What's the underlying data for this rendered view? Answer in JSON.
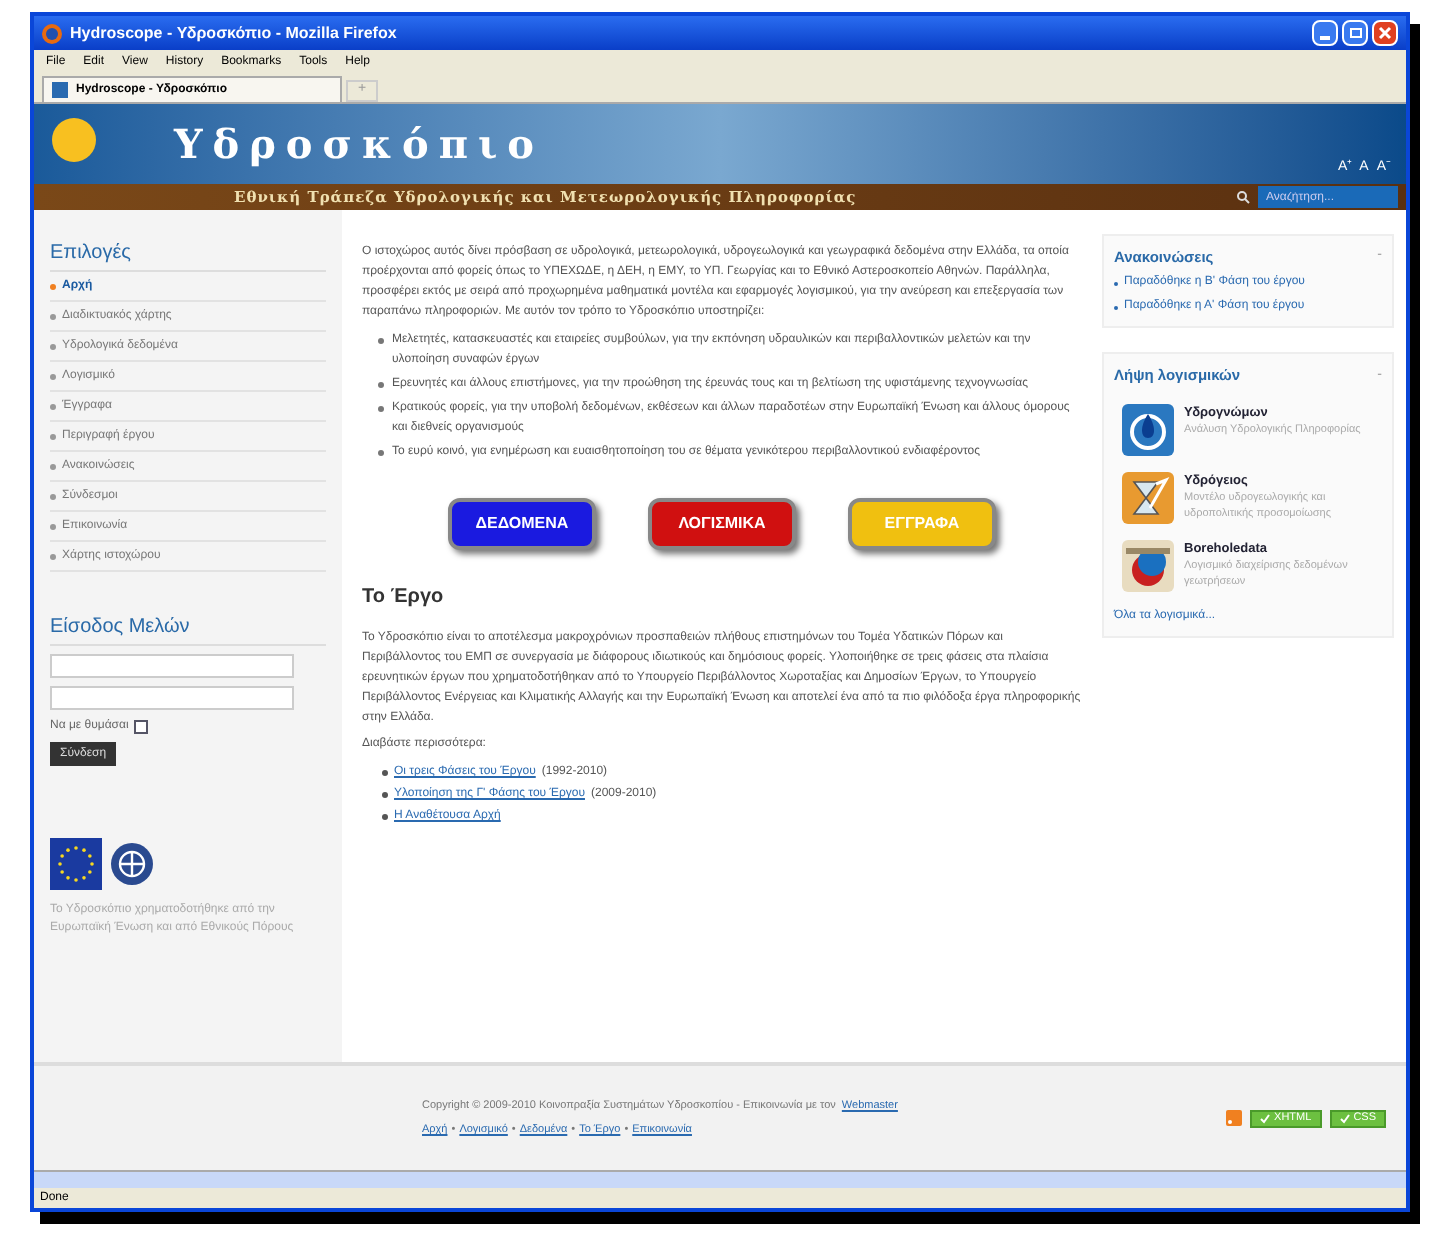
{
  "browser": {
    "title": "Hydroscope - Υδροσκόπιο - Mozilla Firefox",
    "menu": [
      "File",
      "Edit",
      "View",
      "History",
      "Bookmarks",
      "Tools",
      "Help"
    ],
    "tab": "Hydroscope - Υδροσκόπιο",
    "new_tab": "+",
    "status": "Done"
  },
  "header": {
    "title": "Υδροσκόπιο",
    "subtitle": "Εθνική Τράπεζα Υδρολογικής και Μετεωρολογικής Πληροφορίας",
    "font_sizes": [
      "A⁺",
      "A",
      "A⁻"
    ],
    "search": {
      "placeholder": "Αναζήτηση..."
    }
  },
  "sidebar": {
    "menu_title": "Επιλογές",
    "items": [
      {
        "label": "Αρχή",
        "selected": true
      },
      {
        "label": "Διαδικτυακός χάρτης",
        "selected": false
      },
      {
        "label": "Υδρολογικά δεδομένα",
        "selected": false
      },
      {
        "label": "Λογισμικό",
        "selected": false
      },
      {
        "label": "Έγγραφα",
        "selected": false
      },
      {
        "label": "Περιγραφή έργου",
        "selected": false
      },
      {
        "label": "Ανακοινώσεις",
        "selected": false
      },
      {
        "label": "Σύνδεσμοι",
        "selected": false
      },
      {
        "label": "Επικοινωνία",
        "selected": false
      },
      {
        "label": "Χάρτης ιστοχώρου",
        "selected": false
      }
    ],
    "login": {
      "title": "Είσοδος Μελών",
      "remember": {
        "label": "Να με θυμάσαι",
        "checked": false
      },
      "submit": "Σύνδεση"
    },
    "funding": "Το Υδροσκόπιο χρηματοδοτήθηκε από την Ευρωπαϊκή Ένωση και από Εθνικούς Πόρους"
  },
  "main": {
    "intro": "Ο ιστοχώρος αυτός δίνει πρόσβαση σε υδρολογικά, μετεωρολογικά, υδρογεωλογικά και γεωγραφικά δεδομένα στην Ελλάδα, τα οποία προέρχονται από φορείς όπως το ΥΠΕΧΩΔΕ, η ΔΕΗ, η ΕΜΥ, το ΥΠ. Γεωργίας και το Εθνικό Αστεροσκοπείο Αθηνών. Παράλληλα, προσφέρει εκτός με σειρά από προχωρημένα μαθηματικά μοντέλα και εφαρμογές λογισμικού, για την ανεύρεση και επεξεργασία των παραπάνω πληροφοριών. Με αυτόν τον τρόπο το Υδροσκόπιο υποστηρίζει:",
    "bullets": [
      "Μελετητές, κατασκευαστές και εταιρείες συμβούλων, για την εκπόνηση υδραυλικών και περιβαλλοντικών μελετών και την υλοποίηση συναφών έργων",
      "Ερευνητές και άλλους επιστήμονες, για την προώθηση της έρευνάς τους και τη βελτίωση της υφιστάμενης τεχνογνωσίας",
      "Κρατικούς φορείς, για την υποβολή δεδομένων, εκθέσεων και άλλων παραδοτέων στην Ευρωπαϊκή Ένωση και άλλους όμορους και διεθνείς οργανισμούς",
      "Το ευρύ κοινό, για ενημέρωση και ευαισθητοποίηση του σε θέματα γενικότερου περιβαλλοντικού ενδιαφέροντος"
    ],
    "buttons": [
      {
        "label": "ΔΕΔΟΜΕΝΑ",
        "color": "#1a1ae0"
      },
      {
        "label": "ΛΟΓΙΣΜΙΚΑ",
        "color": "#d01010"
      },
      {
        "label": "ΕΓΓΡΑΦΑ",
        "color": "#f0c010"
      }
    ],
    "project": {
      "title": "Το Έργο",
      "text": "Το Υδροσκόπιο είναι το αποτέλεσμα μακροχρόνιων προσπαθειών πλήθους επιστημόνων του Τομέα Υδατικών Πόρων και Περιβάλλοντος του ΕΜΠ σε συνεργασία με διάφορους ιδιωτικούς και δημόσιους φορείς. Υλοποιήθηκε σε τρεις φάσεις στα πλαίσια ερευνητικών έργων που χρηματοδοτήθηκαν από το Υπουργείο Περιβάλλοντος Χωροταξίας και Δημοσίων Έργων, το Υπουργείο Περιβάλλοντος Ενέργειας και Κλιματικής Αλλαγής και την Ευρωπαϊκή Ένωση και αποτελεί ένα από τα πιο φιλόδοξα έργα πληροφορικής στην Ελλάδα.",
      "read_more": "Διαβάστε περισσότερα:",
      "links": [
        {
          "label": "Οι τρεις Φάσεις του Έργου",
          "suffix": "(1992-2010)"
        },
        {
          "label": "Υλοποίηση της Γ' Φάσης του Έργου",
          "suffix": "(2009-2010)"
        },
        {
          "label": "Η Αναθέτουσα Αρχή"
        }
      ]
    }
  },
  "right": {
    "news": {
      "title": "Ανακοινώσεις",
      "toggle": "-",
      "items": [
        "Παραδόθηκε η Β' Φάση του έργου",
        "Παραδόθηκε η Α' Φάση του έργου"
      ]
    },
    "software": {
      "title": "Λήψη λογισμικών",
      "toggle": "-",
      "items": [
        {
          "kind": "drop",
          "name": "Υδρογνώμων",
          "description": "Ανάλυση Υδρολογικής Πληροφορίας"
        },
        {
          "kind": "hourglass",
          "name": "Υδρόγειος",
          "description": "Μοντέλο υδρογεωλογικής και υδροπολιτικής προσομοίωσης"
        },
        {
          "kind": "borehole",
          "name": "Boreholedata",
          "description": "Λογισμικό διαχείρισης δεδομένων γεωτρήσεων"
        }
      ],
      "all_link": "Όλα τα λογισμικά..."
    }
  },
  "footer": {
    "copyright": "Copyright © 2009-2010 Κοινοπραξία Συστημάτων Υδροσκοπίου - Επικοινωνία με τον",
    "webmaster": "Webmaster",
    "separator": "•",
    "links": [
      "Αρχή",
      "Λογισμικό",
      "Δεδομένα",
      "Το Έργο",
      "Επικοινωνία"
    ],
    "badges": [
      "XHTML",
      "CSS"
    ]
  }
}
